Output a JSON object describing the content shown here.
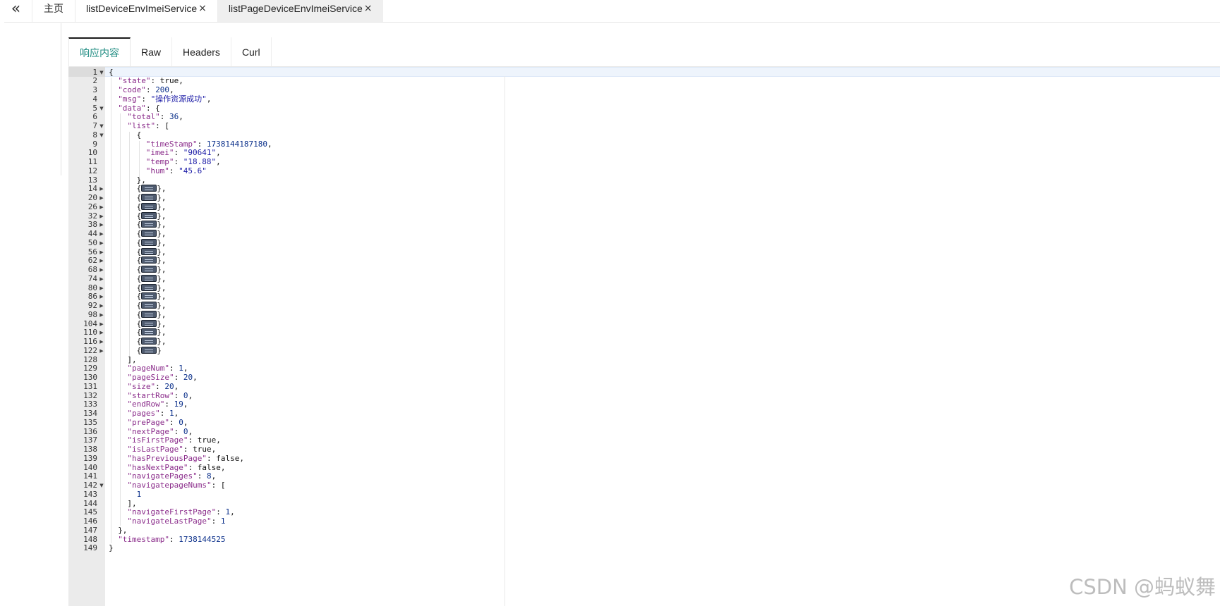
{
  "topbar": {
    "collapse_icon": "double-chevron-left-icon",
    "tabs": [
      {
        "label": "主页"
      },
      {
        "label": "listDeviceEnvImeiService"
      },
      {
        "label": "listPageDeviceEnvImeiService",
        "active": true
      }
    ],
    "close_glyph": "×"
  },
  "response_tabs": [
    {
      "label": "响应内容",
      "active": true
    },
    {
      "label": "Raw"
    },
    {
      "label": "Headers"
    },
    {
      "label": "Curl"
    }
  ],
  "colors": {
    "accent": "#1f8c82",
    "gutter": "#ebebeb",
    "key": "#8a2b8a",
    "number": "#0a2f8a",
    "string": "#1a1aa6"
  },
  "editor": {
    "lines": [
      {
        "n": "1",
        "fold": "open",
        "indent": 0,
        "parts": [
          [
            "punc",
            "{"
          ]
        ]
      },
      {
        "n": "2",
        "indent": 1,
        "parts": [
          [
            "key",
            "\"state\""
          ],
          [
            "punc",
            ": "
          ],
          [
            "bool",
            "true"
          ],
          [
            "punc",
            ","
          ]
        ]
      },
      {
        "n": "3",
        "indent": 1,
        "parts": [
          [
            "key",
            "\"code\""
          ],
          [
            "punc",
            ": "
          ],
          [
            "num",
            "200"
          ],
          [
            "punc",
            ","
          ]
        ]
      },
      {
        "n": "4",
        "indent": 1,
        "parts": [
          [
            "key",
            "\"msg\""
          ],
          [
            "punc",
            ": "
          ],
          [
            "str",
            "\"操作资源成功\""
          ],
          [
            "punc",
            ","
          ]
        ]
      },
      {
        "n": "5",
        "fold": "open",
        "indent": 1,
        "parts": [
          [
            "key",
            "\"data\""
          ],
          [
            "punc",
            ": {"
          ]
        ]
      },
      {
        "n": "6",
        "indent": 2,
        "parts": [
          [
            "key",
            "\"total\""
          ],
          [
            "punc",
            ": "
          ],
          [
            "num",
            "36"
          ],
          [
            "punc",
            ","
          ]
        ]
      },
      {
        "n": "7",
        "fold": "open",
        "indent": 2,
        "parts": [
          [
            "key",
            "\"list\""
          ],
          [
            "punc",
            ": ["
          ]
        ]
      },
      {
        "n": "8",
        "fold": "open",
        "indent": 3,
        "parts": [
          [
            "punc",
            "{"
          ]
        ]
      },
      {
        "n": "9",
        "indent": 4,
        "parts": [
          [
            "key",
            "\"timeStamp\""
          ],
          [
            "punc",
            ": "
          ],
          [
            "num",
            "1738144187180"
          ],
          [
            "punc",
            ","
          ]
        ]
      },
      {
        "n": "10",
        "indent": 4,
        "parts": [
          [
            "key",
            "\"imei\""
          ],
          [
            "punc",
            ": "
          ],
          [
            "str",
            "\"90641\""
          ],
          [
            "punc",
            ","
          ]
        ]
      },
      {
        "n": "11",
        "indent": 4,
        "parts": [
          [
            "key",
            "\"temp\""
          ],
          [
            "punc",
            ": "
          ],
          [
            "str",
            "\"18.88\""
          ],
          [
            "punc",
            ","
          ]
        ]
      },
      {
        "n": "12",
        "indent": 4,
        "parts": [
          [
            "key",
            "\"hum\""
          ],
          [
            "punc",
            ": "
          ],
          [
            "str",
            "\"45.6\""
          ]
        ]
      },
      {
        "n": "13",
        "indent": 3,
        "parts": [
          [
            "punc",
            "},"
          ]
        ]
      },
      {
        "n": "14",
        "fold": "closed",
        "indent": 3,
        "parts": [
          [
            "punc",
            "{"
          ],
          [
            "widget",
            ""
          ],
          [
            "punc",
            "},"
          ]
        ]
      },
      {
        "n": "20",
        "fold": "closed",
        "indent": 3,
        "parts": [
          [
            "punc",
            "{"
          ],
          [
            "widget",
            ""
          ],
          [
            "punc",
            "},"
          ]
        ]
      },
      {
        "n": "26",
        "fold": "closed",
        "indent": 3,
        "parts": [
          [
            "punc",
            "{"
          ],
          [
            "widget",
            ""
          ],
          [
            "punc",
            "},"
          ]
        ]
      },
      {
        "n": "32",
        "fold": "closed",
        "indent": 3,
        "parts": [
          [
            "punc",
            "{"
          ],
          [
            "widget",
            ""
          ],
          [
            "punc",
            "},"
          ]
        ]
      },
      {
        "n": "38",
        "fold": "closed",
        "indent": 3,
        "parts": [
          [
            "punc",
            "{"
          ],
          [
            "widget",
            ""
          ],
          [
            "punc",
            "},"
          ]
        ]
      },
      {
        "n": "44",
        "fold": "closed",
        "indent": 3,
        "parts": [
          [
            "punc",
            "{"
          ],
          [
            "widget",
            ""
          ],
          [
            "punc",
            "},"
          ]
        ]
      },
      {
        "n": "50",
        "fold": "closed",
        "indent": 3,
        "parts": [
          [
            "punc",
            "{"
          ],
          [
            "widget",
            ""
          ],
          [
            "punc",
            "},"
          ]
        ]
      },
      {
        "n": "56",
        "fold": "closed",
        "indent": 3,
        "parts": [
          [
            "punc",
            "{"
          ],
          [
            "widget",
            ""
          ],
          [
            "punc",
            "},"
          ]
        ]
      },
      {
        "n": "62",
        "fold": "closed",
        "indent": 3,
        "parts": [
          [
            "punc",
            "{"
          ],
          [
            "widget",
            ""
          ],
          [
            "punc",
            "},"
          ]
        ]
      },
      {
        "n": "68",
        "fold": "closed",
        "indent": 3,
        "parts": [
          [
            "punc",
            "{"
          ],
          [
            "widget",
            ""
          ],
          [
            "punc",
            "},"
          ]
        ]
      },
      {
        "n": "74",
        "fold": "closed",
        "indent": 3,
        "parts": [
          [
            "punc",
            "{"
          ],
          [
            "widget",
            ""
          ],
          [
            "punc",
            "},"
          ]
        ]
      },
      {
        "n": "80",
        "fold": "closed",
        "indent": 3,
        "parts": [
          [
            "punc",
            "{"
          ],
          [
            "widget",
            ""
          ],
          [
            "punc",
            "},"
          ]
        ]
      },
      {
        "n": "86",
        "fold": "closed",
        "indent": 3,
        "parts": [
          [
            "punc",
            "{"
          ],
          [
            "widget",
            ""
          ],
          [
            "punc",
            "},"
          ]
        ]
      },
      {
        "n": "92",
        "fold": "closed",
        "indent": 3,
        "parts": [
          [
            "punc",
            "{"
          ],
          [
            "widget",
            ""
          ],
          [
            "punc",
            "},"
          ]
        ]
      },
      {
        "n": "98",
        "fold": "closed",
        "indent": 3,
        "parts": [
          [
            "punc",
            "{"
          ],
          [
            "widget",
            ""
          ],
          [
            "punc",
            "},"
          ]
        ]
      },
      {
        "n": "104",
        "fold": "closed",
        "indent": 3,
        "parts": [
          [
            "punc",
            "{"
          ],
          [
            "widget",
            ""
          ],
          [
            "punc",
            "},"
          ]
        ]
      },
      {
        "n": "110",
        "fold": "closed",
        "indent": 3,
        "parts": [
          [
            "punc",
            "{"
          ],
          [
            "widget",
            ""
          ],
          [
            "punc",
            "},"
          ]
        ]
      },
      {
        "n": "116",
        "fold": "closed",
        "indent": 3,
        "parts": [
          [
            "punc",
            "{"
          ],
          [
            "widget",
            ""
          ],
          [
            "punc",
            "},"
          ]
        ]
      },
      {
        "n": "122",
        "fold": "closed",
        "indent": 3,
        "parts": [
          [
            "punc",
            "{"
          ],
          [
            "widget",
            ""
          ],
          [
            "punc",
            "}"
          ]
        ]
      },
      {
        "n": "128",
        "indent": 2,
        "parts": [
          [
            "punc",
            "],"
          ]
        ]
      },
      {
        "n": "129",
        "indent": 2,
        "parts": [
          [
            "key",
            "\"pageNum\""
          ],
          [
            "punc",
            ": "
          ],
          [
            "num",
            "1"
          ],
          [
            "punc",
            ","
          ]
        ]
      },
      {
        "n": "130",
        "indent": 2,
        "parts": [
          [
            "key",
            "\"pageSize\""
          ],
          [
            "punc",
            ": "
          ],
          [
            "num",
            "20"
          ],
          [
            "punc",
            ","
          ]
        ]
      },
      {
        "n": "131",
        "indent": 2,
        "parts": [
          [
            "key",
            "\"size\""
          ],
          [
            "punc",
            ": "
          ],
          [
            "num",
            "20"
          ],
          [
            "punc",
            ","
          ]
        ]
      },
      {
        "n": "132",
        "indent": 2,
        "parts": [
          [
            "key",
            "\"startRow\""
          ],
          [
            "punc",
            ": "
          ],
          [
            "num",
            "0"
          ],
          [
            "punc",
            ","
          ]
        ]
      },
      {
        "n": "133",
        "indent": 2,
        "parts": [
          [
            "key",
            "\"endRow\""
          ],
          [
            "punc",
            ": "
          ],
          [
            "num",
            "19"
          ],
          [
            "punc",
            ","
          ]
        ]
      },
      {
        "n": "134",
        "indent": 2,
        "parts": [
          [
            "key",
            "\"pages\""
          ],
          [
            "punc",
            ": "
          ],
          [
            "num",
            "1"
          ],
          [
            "punc",
            ","
          ]
        ]
      },
      {
        "n": "135",
        "indent": 2,
        "parts": [
          [
            "key",
            "\"prePage\""
          ],
          [
            "punc",
            ": "
          ],
          [
            "num",
            "0"
          ],
          [
            "punc",
            ","
          ]
        ]
      },
      {
        "n": "136",
        "indent": 2,
        "parts": [
          [
            "key",
            "\"nextPage\""
          ],
          [
            "punc",
            ": "
          ],
          [
            "num",
            "0"
          ],
          [
            "punc",
            ","
          ]
        ]
      },
      {
        "n": "137",
        "indent": 2,
        "parts": [
          [
            "key",
            "\"isFirstPage\""
          ],
          [
            "punc",
            ": "
          ],
          [
            "bool",
            "true"
          ],
          [
            "punc",
            ","
          ]
        ]
      },
      {
        "n": "138",
        "indent": 2,
        "parts": [
          [
            "key",
            "\"isLastPage\""
          ],
          [
            "punc",
            ": "
          ],
          [
            "bool",
            "true"
          ],
          [
            "punc",
            ","
          ]
        ]
      },
      {
        "n": "139",
        "indent": 2,
        "parts": [
          [
            "key",
            "\"hasPreviousPage\""
          ],
          [
            "punc",
            ": "
          ],
          [
            "bool",
            "false"
          ],
          [
            "punc",
            ","
          ]
        ]
      },
      {
        "n": "140",
        "indent": 2,
        "parts": [
          [
            "key",
            "\"hasNextPage\""
          ],
          [
            "punc",
            ": "
          ],
          [
            "bool",
            "false"
          ],
          [
            "punc",
            ","
          ]
        ]
      },
      {
        "n": "141",
        "indent": 2,
        "parts": [
          [
            "key",
            "\"navigatePages\""
          ],
          [
            "punc",
            ": "
          ],
          [
            "num",
            "8"
          ],
          [
            "punc",
            ","
          ]
        ]
      },
      {
        "n": "142",
        "fold": "open",
        "indent": 2,
        "parts": [
          [
            "key",
            "\"navigatepageNums\""
          ],
          [
            "punc",
            ": ["
          ]
        ]
      },
      {
        "n": "143",
        "indent": 3,
        "parts": [
          [
            "num",
            "1"
          ]
        ]
      },
      {
        "n": "144",
        "indent": 2,
        "parts": [
          [
            "punc",
            "],"
          ]
        ]
      },
      {
        "n": "145",
        "indent": 2,
        "parts": [
          [
            "key",
            "\"navigateFirstPage\""
          ],
          [
            "punc",
            ": "
          ],
          [
            "num",
            "1"
          ],
          [
            "punc",
            ","
          ]
        ]
      },
      {
        "n": "146",
        "indent": 2,
        "parts": [
          [
            "key",
            "\"navigateLastPage\""
          ],
          [
            "punc",
            ": "
          ],
          [
            "num",
            "1"
          ]
        ]
      },
      {
        "n": "147",
        "indent": 1,
        "parts": [
          [
            "punc",
            "},"
          ]
        ]
      },
      {
        "n": "148",
        "indent": 1,
        "parts": [
          [
            "key",
            "\"timestamp\""
          ],
          [
            "punc",
            ": "
          ],
          [
            "num",
            "1738144525"
          ]
        ]
      },
      {
        "n": "149",
        "indent": 0,
        "parts": [
          [
            "punc",
            "}"
          ]
        ]
      }
    ]
  },
  "watermark": "CSDN @蚂蚁舞"
}
